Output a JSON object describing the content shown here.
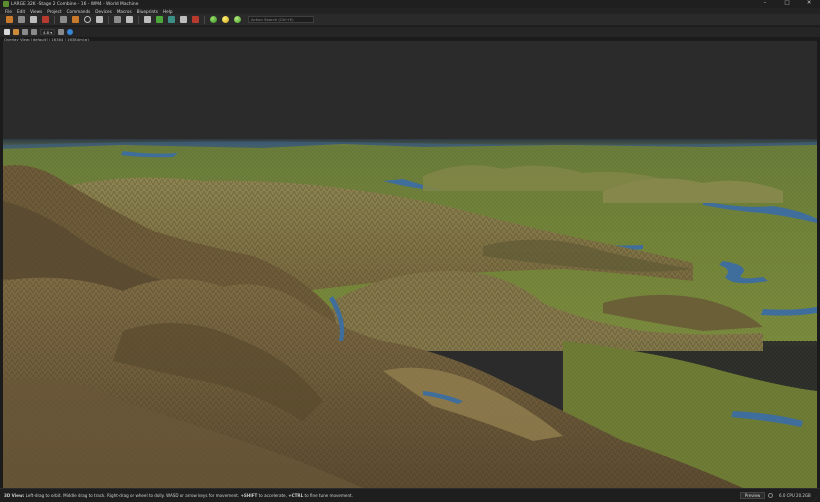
{
  "window": {
    "title": "LARGE 32K -Stage 2 Combine - 16 - WM4 - World Machine",
    "controls": [
      "–",
      "□",
      "✕"
    ]
  },
  "menu": [
    "File",
    "Edit",
    "Views",
    "Project",
    "Commands",
    "Devices",
    "Macros",
    "Blueprints",
    "Help"
  ],
  "toolbar": {
    "search_placeholder": "Action Search (Ctrl+E)"
  },
  "viewbar": {
    "mode_label": "4.8"
  },
  "overlay_info": "Overlay View: [default] | 16384 | 16384m(≠)",
  "status": {
    "view_label": "3D View:",
    "help_text": " Left-drag to orbit. Middle drag to track. Right-drag or wheel to dolly. WASD or arrow keys for movement. ",
    "shift_key": "+SHIFT",
    "shift_text": " to accelerate, ",
    "ctrl_key": "+CTRL",
    "ctrl_text": " to fine tune movement.",
    "preview_label": "Preview",
    "cpu_text": "6.0 CPU 20.2GB"
  },
  "colors": {
    "sky": "#2b2b2b",
    "mountains_near": "#7d6a44",
    "mountains_mid": "#8a8048",
    "valley_green": "#6e7f35",
    "water": "#3f6e9c",
    "accent_green": "#5a8e2f"
  }
}
